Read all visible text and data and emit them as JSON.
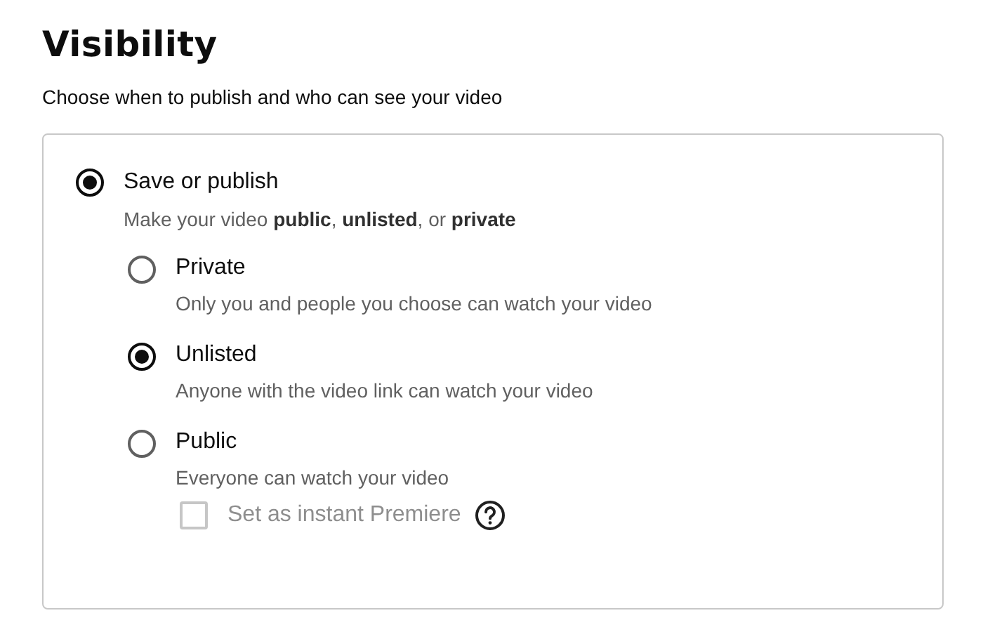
{
  "title": "Visibility",
  "subtitle": "Choose when to publish and who can see your video",
  "main_option": {
    "label": "Save or publish",
    "description": "Make your video **public**, **unlisted**, or **private**",
    "selected": true
  },
  "sub_options": [
    {
      "label": "Private",
      "description": "Only you and people you choose can watch your video",
      "selected": false
    },
    {
      "label": "Unlisted",
      "description": "Anyone with the video link can watch your video",
      "selected": true
    },
    {
      "label": "Public",
      "description": "Everyone can watch your video",
      "selected": false
    }
  ],
  "premiere": {
    "label": "Set as instant Premiere",
    "checked": false,
    "disabled": true
  }
}
